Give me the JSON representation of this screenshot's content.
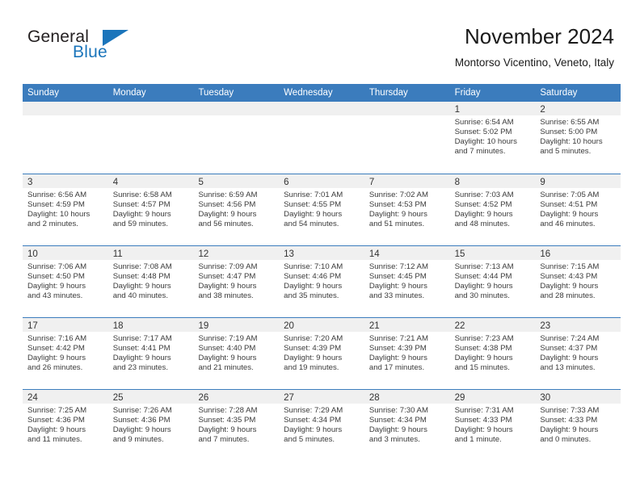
{
  "brand": {
    "name_part1": "General",
    "name_part2": "Blue",
    "flag_icon": "blue-triangle-flag"
  },
  "header": {
    "title": "November 2024",
    "location": "Montorso Vicentino, Veneto, Italy"
  },
  "colors": {
    "header_blue": "#3b7cbd",
    "brand_blue": "#1b75bb",
    "day_band_gray": "#f0f0f0",
    "text": "#3a3a3a"
  },
  "weekdays": [
    "Sunday",
    "Monday",
    "Tuesday",
    "Wednesday",
    "Thursday",
    "Friday",
    "Saturday"
  ],
  "weeks": [
    [
      {
        "day": "",
        "sunrise": "",
        "sunset": "",
        "daylight_line1": "",
        "daylight_line2": ""
      },
      {
        "day": "",
        "sunrise": "",
        "sunset": "",
        "daylight_line1": "",
        "daylight_line2": ""
      },
      {
        "day": "",
        "sunrise": "",
        "sunset": "",
        "daylight_line1": "",
        "daylight_line2": ""
      },
      {
        "day": "",
        "sunrise": "",
        "sunset": "",
        "daylight_line1": "",
        "daylight_line2": ""
      },
      {
        "day": "",
        "sunrise": "",
        "sunset": "",
        "daylight_line1": "",
        "daylight_line2": ""
      },
      {
        "day": "1",
        "sunrise": "Sunrise: 6:54 AM",
        "sunset": "Sunset: 5:02 PM",
        "daylight_line1": "Daylight: 10 hours",
        "daylight_line2": "and 7 minutes."
      },
      {
        "day": "2",
        "sunrise": "Sunrise: 6:55 AM",
        "sunset": "Sunset: 5:00 PM",
        "daylight_line1": "Daylight: 10 hours",
        "daylight_line2": "and 5 minutes."
      }
    ],
    [
      {
        "day": "3",
        "sunrise": "Sunrise: 6:56 AM",
        "sunset": "Sunset: 4:59 PM",
        "daylight_line1": "Daylight: 10 hours",
        "daylight_line2": "and 2 minutes."
      },
      {
        "day": "4",
        "sunrise": "Sunrise: 6:58 AM",
        "sunset": "Sunset: 4:57 PM",
        "daylight_line1": "Daylight: 9 hours",
        "daylight_line2": "and 59 minutes."
      },
      {
        "day": "5",
        "sunrise": "Sunrise: 6:59 AM",
        "sunset": "Sunset: 4:56 PM",
        "daylight_line1": "Daylight: 9 hours",
        "daylight_line2": "and 56 minutes."
      },
      {
        "day": "6",
        "sunrise": "Sunrise: 7:01 AM",
        "sunset": "Sunset: 4:55 PM",
        "daylight_line1": "Daylight: 9 hours",
        "daylight_line2": "and 54 minutes."
      },
      {
        "day": "7",
        "sunrise": "Sunrise: 7:02 AM",
        "sunset": "Sunset: 4:53 PM",
        "daylight_line1": "Daylight: 9 hours",
        "daylight_line2": "and 51 minutes."
      },
      {
        "day": "8",
        "sunrise": "Sunrise: 7:03 AM",
        "sunset": "Sunset: 4:52 PM",
        "daylight_line1": "Daylight: 9 hours",
        "daylight_line2": "and 48 minutes."
      },
      {
        "day": "9",
        "sunrise": "Sunrise: 7:05 AM",
        "sunset": "Sunset: 4:51 PM",
        "daylight_line1": "Daylight: 9 hours",
        "daylight_line2": "and 46 minutes."
      }
    ],
    [
      {
        "day": "10",
        "sunrise": "Sunrise: 7:06 AM",
        "sunset": "Sunset: 4:50 PM",
        "daylight_line1": "Daylight: 9 hours",
        "daylight_line2": "and 43 minutes."
      },
      {
        "day": "11",
        "sunrise": "Sunrise: 7:08 AM",
        "sunset": "Sunset: 4:48 PM",
        "daylight_line1": "Daylight: 9 hours",
        "daylight_line2": "and 40 minutes."
      },
      {
        "day": "12",
        "sunrise": "Sunrise: 7:09 AM",
        "sunset": "Sunset: 4:47 PM",
        "daylight_line1": "Daylight: 9 hours",
        "daylight_line2": "and 38 minutes."
      },
      {
        "day": "13",
        "sunrise": "Sunrise: 7:10 AM",
        "sunset": "Sunset: 4:46 PM",
        "daylight_line1": "Daylight: 9 hours",
        "daylight_line2": "and 35 minutes."
      },
      {
        "day": "14",
        "sunrise": "Sunrise: 7:12 AM",
        "sunset": "Sunset: 4:45 PM",
        "daylight_line1": "Daylight: 9 hours",
        "daylight_line2": "and 33 minutes."
      },
      {
        "day": "15",
        "sunrise": "Sunrise: 7:13 AM",
        "sunset": "Sunset: 4:44 PM",
        "daylight_line1": "Daylight: 9 hours",
        "daylight_line2": "and 30 minutes."
      },
      {
        "day": "16",
        "sunrise": "Sunrise: 7:15 AM",
        "sunset": "Sunset: 4:43 PM",
        "daylight_line1": "Daylight: 9 hours",
        "daylight_line2": "and 28 minutes."
      }
    ],
    [
      {
        "day": "17",
        "sunrise": "Sunrise: 7:16 AM",
        "sunset": "Sunset: 4:42 PM",
        "daylight_line1": "Daylight: 9 hours",
        "daylight_line2": "and 26 minutes."
      },
      {
        "day": "18",
        "sunrise": "Sunrise: 7:17 AM",
        "sunset": "Sunset: 4:41 PM",
        "daylight_line1": "Daylight: 9 hours",
        "daylight_line2": "and 23 minutes."
      },
      {
        "day": "19",
        "sunrise": "Sunrise: 7:19 AM",
        "sunset": "Sunset: 4:40 PM",
        "daylight_line1": "Daylight: 9 hours",
        "daylight_line2": "and 21 minutes."
      },
      {
        "day": "20",
        "sunrise": "Sunrise: 7:20 AM",
        "sunset": "Sunset: 4:39 PM",
        "daylight_line1": "Daylight: 9 hours",
        "daylight_line2": "and 19 minutes."
      },
      {
        "day": "21",
        "sunrise": "Sunrise: 7:21 AM",
        "sunset": "Sunset: 4:39 PM",
        "daylight_line1": "Daylight: 9 hours",
        "daylight_line2": "and 17 minutes."
      },
      {
        "day": "22",
        "sunrise": "Sunrise: 7:23 AM",
        "sunset": "Sunset: 4:38 PM",
        "daylight_line1": "Daylight: 9 hours",
        "daylight_line2": "and 15 minutes."
      },
      {
        "day": "23",
        "sunrise": "Sunrise: 7:24 AM",
        "sunset": "Sunset: 4:37 PM",
        "daylight_line1": "Daylight: 9 hours",
        "daylight_line2": "and 13 minutes."
      }
    ],
    [
      {
        "day": "24",
        "sunrise": "Sunrise: 7:25 AM",
        "sunset": "Sunset: 4:36 PM",
        "daylight_line1": "Daylight: 9 hours",
        "daylight_line2": "and 11 minutes."
      },
      {
        "day": "25",
        "sunrise": "Sunrise: 7:26 AM",
        "sunset": "Sunset: 4:36 PM",
        "daylight_line1": "Daylight: 9 hours",
        "daylight_line2": "and 9 minutes."
      },
      {
        "day": "26",
        "sunrise": "Sunrise: 7:28 AM",
        "sunset": "Sunset: 4:35 PM",
        "daylight_line1": "Daylight: 9 hours",
        "daylight_line2": "and 7 minutes."
      },
      {
        "day": "27",
        "sunrise": "Sunrise: 7:29 AM",
        "sunset": "Sunset: 4:34 PM",
        "daylight_line1": "Daylight: 9 hours",
        "daylight_line2": "and 5 minutes."
      },
      {
        "day": "28",
        "sunrise": "Sunrise: 7:30 AM",
        "sunset": "Sunset: 4:34 PM",
        "daylight_line1": "Daylight: 9 hours",
        "daylight_line2": "and 3 minutes."
      },
      {
        "day": "29",
        "sunrise": "Sunrise: 7:31 AM",
        "sunset": "Sunset: 4:33 PM",
        "daylight_line1": "Daylight: 9 hours",
        "daylight_line2": "and 1 minute."
      },
      {
        "day": "30",
        "sunrise": "Sunrise: 7:33 AM",
        "sunset": "Sunset: 4:33 PM",
        "daylight_line1": "Daylight: 9 hours",
        "daylight_line2": "and 0 minutes."
      }
    ]
  ]
}
